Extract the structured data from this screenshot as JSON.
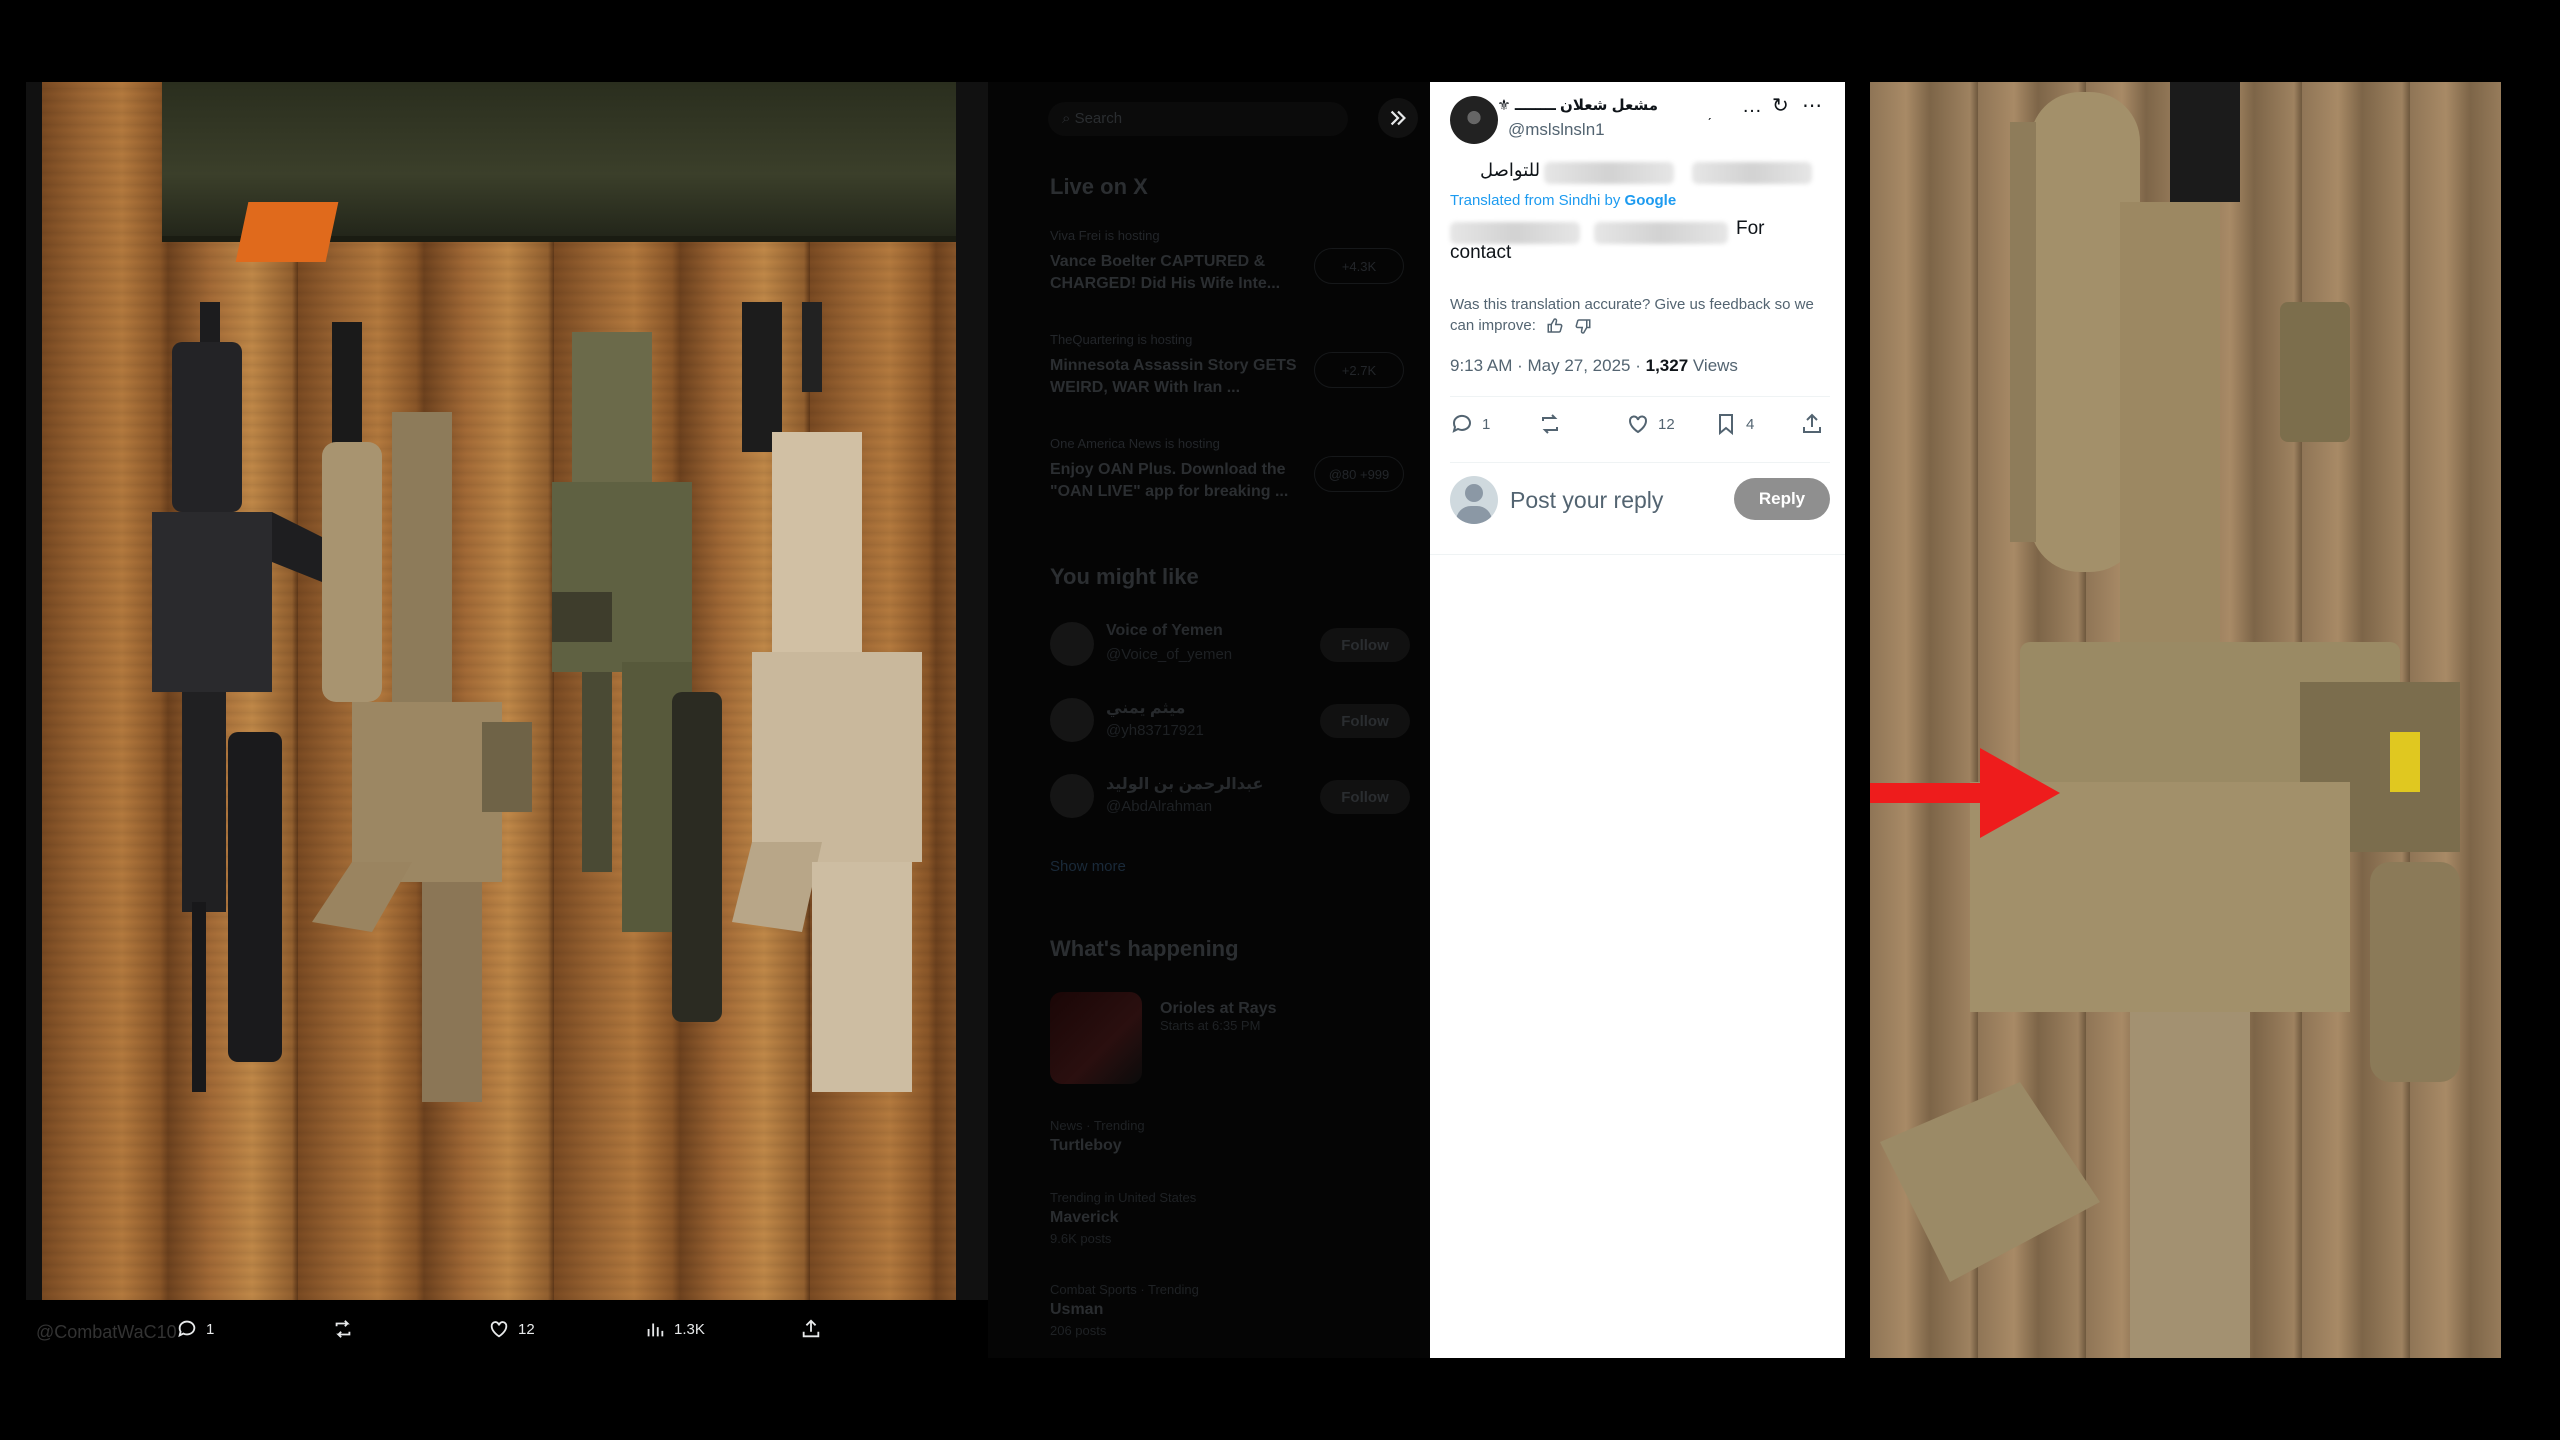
{
  "left_panel": {
    "watermark": "@CombatWaC10",
    "actions": {
      "replies": "1",
      "likes": "12",
      "views": "1.3K"
    }
  },
  "mid_panel": {
    "search_placeholder": "Search",
    "live_heading": "Live on X",
    "live_items": [
      {
        "host": "Viva Frei",
        "status": "is hosting",
        "title": "Vance Boelter CAPTURED & CHARGED! Did His Wife Inte...",
        "count": "+4.3K"
      },
      {
        "host": "TheQuartering",
        "status": "is hosting",
        "title": "Minnesota Assassin Story GETS WEIRD, WAR With Iran ...",
        "count": "+2.7K"
      },
      {
        "host": "One America News",
        "status": "is hosting",
        "title": "Enjoy OAN Plus. Download the \"OAN LIVE\" app for breaking ...",
        "count": "@80 +999"
      }
    ],
    "suggest_heading": "You might like",
    "suggestions": [
      {
        "name": "Voice of Yemen",
        "handle": "@Voice_of_yemen",
        "follow": "Follow"
      },
      {
        "name": "ميثم يمني",
        "handle": "@yh83717921",
        "follow": "Follow"
      },
      {
        "name": "عبدالرحمن بن الوليد",
        "handle": "@AbdAlrahman",
        "follow": "Follow"
      }
    ],
    "show_more": "Show more",
    "happening_heading": "What's happening",
    "happening": {
      "title": "Orioles at Rays",
      "meta": "Starts at 6:35 PM"
    },
    "trends": [
      {
        "meta": "News · Trending",
        "title": "Turtleboy",
        "posts": ""
      },
      {
        "meta": "Trending in United States",
        "title": "Maverick",
        "posts": "9.6K posts"
      },
      {
        "meta": "Combat Sports · Trending",
        "title": "Usman",
        "posts": "206 posts"
      }
    ]
  },
  "tweet": {
    "display_name": "مشعل شعلان ــــــــ ⚜",
    "handle": "@mslslnsln1",
    "arabic_text": "للتواصل",
    "translated_prefix": "Translated from Sindhi by ",
    "translated_brand": "Google",
    "for_text": "For",
    "contact_text": "contact",
    "feedback": "Was this translation accurate? Give us feedback so we can improve:",
    "time": "9:13 AM · May 27, 2025 · ",
    "views_count": "1,327",
    "views_label": " Views",
    "replies": "1",
    "likes": "12",
    "bookmarks": "4",
    "reply_placeholder": "Post your reply",
    "reply_button": "Reply"
  },
  "colors": {
    "accent_blue": "#1d9bf0",
    "arrow_red": "#ee1c1c",
    "reply_button_gray": "#8f8f8f"
  }
}
